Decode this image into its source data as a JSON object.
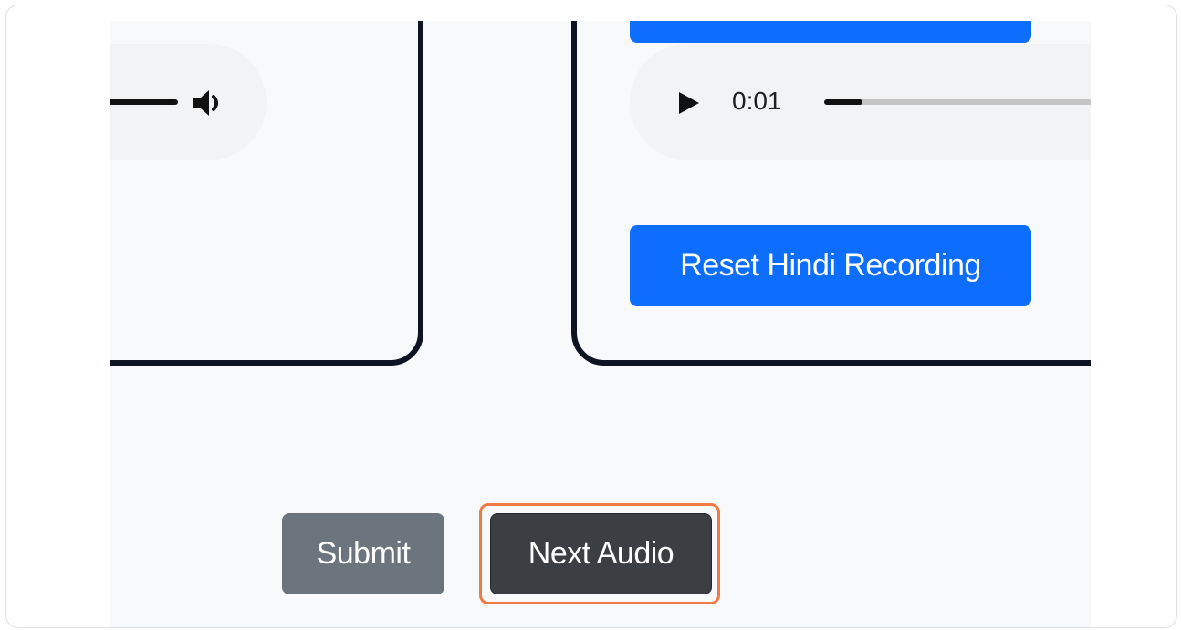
{
  "left_panel": {
    "audio_player": {
      "progress_fraction": 1.0,
      "volume_icon": "volume-icon"
    }
  },
  "right_panel": {
    "audio_player": {
      "time": "0:01",
      "progress_fraction": 0.1,
      "play_icon": "play-icon"
    },
    "reset_button_label": "Reset Hindi Recording"
  },
  "actions": {
    "submit_label": "Submit",
    "next_label": "Next Audio",
    "highlight_color": "#f07a46"
  },
  "colors": {
    "primary": "#0d6efd",
    "secondary": "#6c757d",
    "dark": "#3b3e43",
    "card_border": "#0f1424"
  }
}
